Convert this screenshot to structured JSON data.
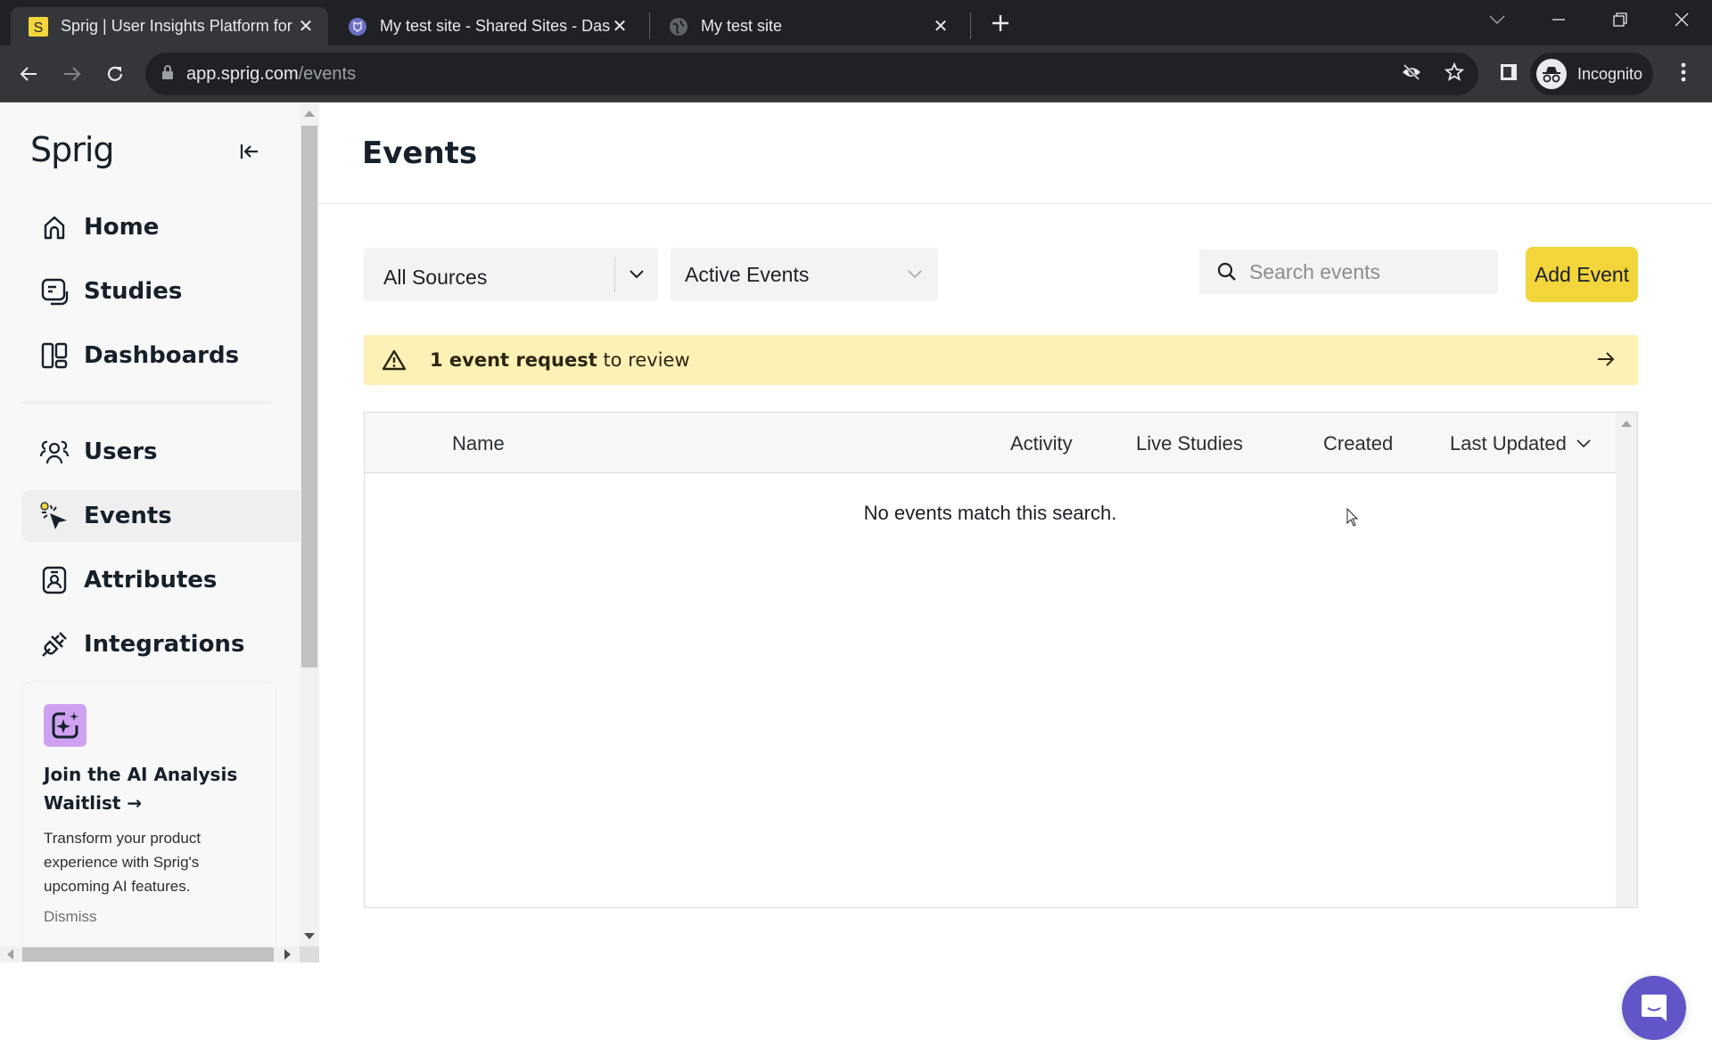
{
  "browser": {
    "tabs": [
      {
        "title": "Sprig | User Insights Platform for",
        "favicon": "sprig-s-icon",
        "active": true
      },
      {
        "title": "My test site - Shared Sites - Dash",
        "favicon": "shield-site-icon",
        "active": false
      },
      {
        "title": "My test site",
        "favicon": "globe-icon",
        "active": false
      }
    ],
    "url_host": "app.sprig.com",
    "url_path": "/events",
    "profile_label": "Incognito"
  },
  "sidebar": {
    "logo": "Sprig",
    "items": [
      {
        "label": "Home",
        "icon": "home-icon",
        "active": false
      },
      {
        "label": "Studies",
        "icon": "studies-icon",
        "active": false
      },
      {
        "label": "Dashboards",
        "icon": "dashboards-icon",
        "active": false
      },
      {
        "label": "Users",
        "icon": "users-icon",
        "active": false
      },
      {
        "label": "Events",
        "icon": "events-icon",
        "active": true
      },
      {
        "label": "Attributes",
        "icon": "attributes-icon",
        "active": false
      },
      {
        "label": "Integrations",
        "icon": "integrations-icon",
        "active": false
      }
    ],
    "promo": {
      "title": "Join the AI Analysis Waitlist →",
      "description": "Transform your product experience with Sprig's upcoming AI features.",
      "dismiss": "Dismiss"
    }
  },
  "main": {
    "title": "Events",
    "filters": {
      "source": "All Sources",
      "status": "Active Events"
    },
    "search": {
      "placeholder": "Search events",
      "value": ""
    },
    "add_button": "Add Event",
    "banner": {
      "bold": "1 event request",
      "rest": " to review"
    },
    "table": {
      "columns": [
        "Name",
        "Activity",
        "Live Studies",
        "Created",
        "Last Updated"
      ],
      "sorted_column": "Last Updated",
      "empty_message": "No events match this search."
    }
  },
  "colors": {
    "accent_yellow": "#f2d43b",
    "banner_bg": "#fdf1b6",
    "chat_purple": "#6156c7",
    "promo_badge": "#cfa2f1"
  }
}
